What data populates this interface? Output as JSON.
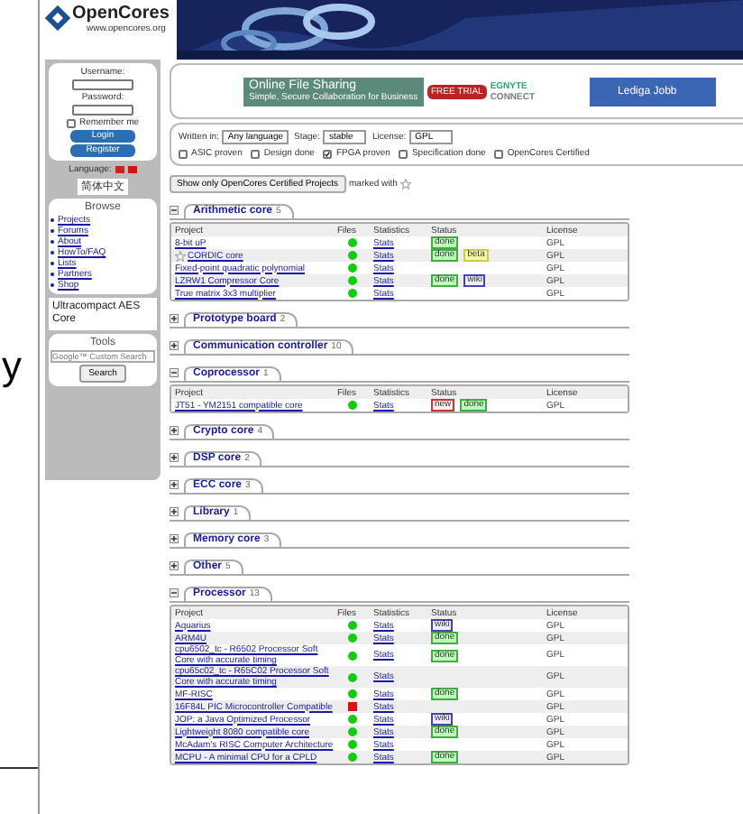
{
  "outer": {
    "letter": "y"
  },
  "header": {
    "logo": "OpenCores",
    "url": "www.opencores.org"
  },
  "login": {
    "username": "Username:",
    "password": "Password:",
    "remember": "Remember me",
    "remember_checked": false,
    "login": "Login",
    "register": "Register"
  },
  "language": {
    "label": "Language:",
    "translate": "简体中文"
  },
  "browse": {
    "title": "Browse",
    "items": [
      "Projects",
      "Forums",
      "About",
      "HowTo/FAQ",
      "Lists",
      "Partners",
      "Shop"
    ]
  },
  "side_ad": {
    "title": "Ultracompact AES Core"
  },
  "tools": {
    "title": "Tools",
    "placeholder": "Google™ Custom Search",
    "button": "Search"
  },
  "ad": {
    "title": "Online File Sharing",
    "subtitle": "Simple, Secure Collaboration for Business",
    "trial": "FREE TRIAL",
    "brand_1": "EGNYTE",
    "brand_2": "CONNECT",
    "job": "Lediga Jobb"
  },
  "filters": {
    "selects": [
      {
        "label": "Written in:",
        "value": "Any language"
      },
      {
        "label": "Stage:",
        "value": "stable"
      },
      {
        "label": "License:",
        "value": "GPL"
      }
    ],
    "checks": [
      {
        "label": "ASIC proven",
        "checked": false
      },
      {
        "label": "Design done",
        "checked": false
      },
      {
        "label": "FPGA proven",
        "checked": true
      },
      {
        "label": "Specification done",
        "checked": false
      },
      {
        "label": "OpenCores Certified",
        "checked": false
      }
    ]
  },
  "certified": {
    "button": "Show only OpenCores Certified Projects",
    "note": "marked with"
  },
  "sections": [
    {
      "name": "Arithmetic core",
      "count": "5",
      "expanded": true,
      "columns": [
        "Project",
        "Files",
        "Statistics",
        "Status",
        "License"
      ],
      "rows": [
        {
          "project": "8-bit uP",
          "files_ok": true,
          "stats": "Stats",
          "tags": [
            {
              "label": "done",
              "kind": "done"
            }
          ],
          "license": "GPL"
        },
        {
          "project": "CORDIC core",
          "starred": true,
          "files_ok": true,
          "stats": "Stats",
          "tags": [
            {
              "label": "done",
              "kind": "done"
            },
            {
              "label": "beta",
              "kind": "beta"
            }
          ],
          "license": "GPL"
        },
        {
          "project": "Fixed-point quadratic polynomial",
          "files_ok": true,
          "stats": "Stats",
          "tags": [],
          "license": "GPL"
        },
        {
          "project": "LZRW1 Compressor Core",
          "files_ok": true,
          "stats": "Stats",
          "tags": [
            {
              "label": "done",
              "kind": "done"
            },
            {
              "label": "wiki",
              "kind": "wiki"
            }
          ],
          "license": "GPL"
        },
        {
          "project": "True matrix 3x3 multiplier",
          "files_ok": true,
          "stats": "Stats",
          "tags": [],
          "license": "GPL"
        }
      ]
    },
    {
      "name": "Prototype board",
      "count": "2",
      "expanded": false
    },
    {
      "name": "Communication controller",
      "count": "10",
      "expanded": false
    },
    {
      "name": "Coprocessor",
      "count": "1",
      "expanded": true,
      "columns": [
        "Project",
        "Files",
        "Statistics",
        "Status",
        "License"
      ],
      "rows": [
        {
          "project": "JT51 - YM2151 compatible core",
          "files_ok": true,
          "stats": "Stats",
          "tags": [
            {
              "label": "new",
              "kind": "new"
            },
            {
              "label": "done",
              "kind": "done"
            }
          ],
          "license": "GPL"
        }
      ]
    },
    {
      "name": "Crypto core",
      "count": "4",
      "expanded": false
    },
    {
      "name": "DSP core",
      "count": "2",
      "expanded": false
    },
    {
      "name": "ECC core",
      "count": "3",
      "expanded": false
    },
    {
      "name": "Library",
      "count": "1",
      "expanded": false
    },
    {
      "name": "Memory core",
      "count": "3",
      "expanded": false
    },
    {
      "name": "Other",
      "count": "5",
      "expanded": false
    },
    {
      "name": "Processor",
      "count": "13",
      "expanded": true,
      "columns": [
        "Project",
        "Files",
        "Statistics",
        "Status",
        "License"
      ],
      "rows": [
        {
          "project": "Aquarius",
          "files_ok": true,
          "stats": "Stats",
          "tags": [
            {
              "label": "wiki",
              "kind": "wiki"
            }
          ],
          "license": "GPL"
        },
        {
          "project": "ARM4U",
          "files_ok": true,
          "stats": "Stats",
          "tags": [
            {
              "label": "done",
              "kind": "done"
            }
          ],
          "license": "GPL"
        },
        {
          "project": "cpu6502_tc - R6502 Processor Soft Core with accurate timing",
          "files_ok": true,
          "stats": "Stats",
          "tags": [
            {
              "label": "done",
              "kind": "done"
            }
          ],
          "license": "GPL"
        },
        {
          "project": "cpu65c02_tc - R65C02 Processor Soft Core with accurate timing",
          "files_ok": true,
          "stats": "Stats",
          "tags": [],
          "license": "GPL"
        },
        {
          "project": "MF-RISC",
          "files_ok": true,
          "stats": "Stats",
          "tags": [
            {
              "label": "done",
              "kind": "done"
            }
          ],
          "license": "GPL"
        },
        {
          "project": "16F84L PIC Microcontroller Compatible",
          "files_ok": false,
          "stats": "Stats",
          "tags": [],
          "license": "GPL"
        },
        {
          "project": "JOP: a Java Optimized Processor",
          "files_ok": true,
          "stats": "Stats",
          "tags": [
            {
              "label": "wiki",
              "kind": "wiki"
            }
          ],
          "license": "GPL"
        },
        {
          "project": "Lightweight 8080 compatible core",
          "files_ok": true,
          "stats": "Stats",
          "tags": [
            {
              "label": "done",
              "kind": "done"
            }
          ],
          "license": "GPL"
        },
        {
          "project": "McAdam's RISC Computer Architecture",
          "files_ok": true,
          "stats": "Stats",
          "tags": [],
          "license": "GPL"
        },
        {
          "project": "MCPU - A minimal CPU for a CPLD",
          "files_ok": true,
          "stats": "Stats",
          "tags": [
            {
              "label": "done",
              "kind": "done"
            }
          ],
          "license": "GPL"
        }
      ]
    }
  ]
}
